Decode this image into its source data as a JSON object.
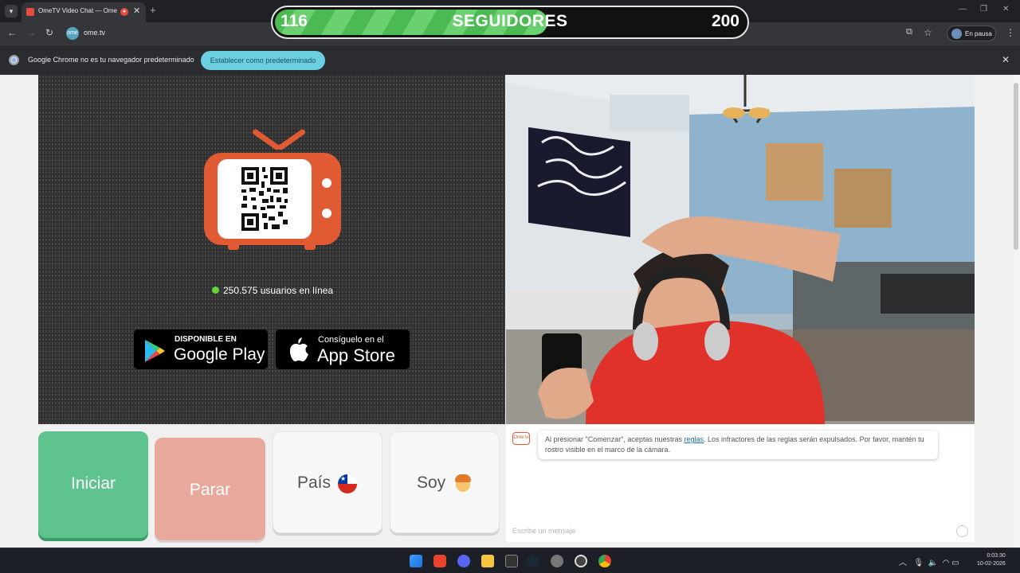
{
  "browser": {
    "tab_title": "OmeTV Video Chat — Ome",
    "url": "ome.tv",
    "profile_label": "En pausa",
    "infobar_text": "Google Chrome no es tu navegador predeterminado",
    "infobar_button": "Establecer como predeterminado"
  },
  "followers_goal": {
    "current": "116",
    "label": "SEGUIDORES",
    "goal": "200",
    "progress": 0.58
  },
  "left_panel": {
    "online_count": "250.575 usuarios en línea",
    "google_play": {
      "small": "DISPONIBLE EN",
      "big": "Google Play"
    },
    "app_store": {
      "small": "Consíguelo en el",
      "big": "App Store"
    }
  },
  "controls": {
    "start": "Iniciar",
    "stop": "Parar",
    "country": "País",
    "gender": "Soy"
  },
  "chat": {
    "logo_text": "Ome tv",
    "message_before": "Al presionar \"Comenzar\", aceptas nuestras ",
    "message_link": "reglas",
    "message_after": ". Los infractores de las reglas serán expulsados. Por favor, mantén tu rostro visible en el marco de la cámara.",
    "input_placeholder": "Escribe un mensaje"
  },
  "taskbar": {
    "time": "0:03:30",
    "date": "10-02-2026"
  },
  "colors": {
    "accent_green": "#5ec38c",
    "stop_salmon": "#e8a89c",
    "brand_orange": "#e05a34"
  }
}
